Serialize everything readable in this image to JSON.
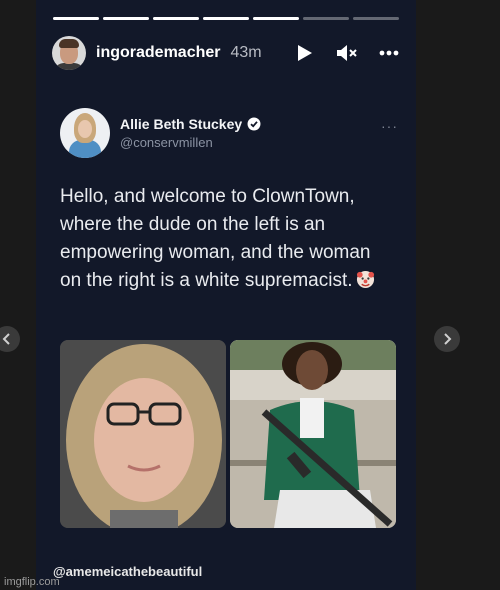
{
  "story": {
    "progress_total": 7,
    "progress_completed": 5,
    "username": "ingorademacher",
    "time_ago": "43m",
    "controls": [
      "play-icon",
      "mute-icon",
      "more-icon"
    ]
  },
  "post": {
    "author_name": "Allie Beth Stuckey",
    "handle": "@conservmillen",
    "text": "Hello, and welcome to ClownTown, where the dude on the left is an empowering woman, and the woman on the right is a white supremacist.",
    "emoji_icon": "clown-face-icon",
    "more_label": "···"
  },
  "footer_handle": "@amemeicathebeautiful",
  "watermark": "imgflip.com",
  "colors": {
    "background": "#1c1c1c",
    "story_background": "#121829",
    "accent_verified": "#ffffff"
  }
}
